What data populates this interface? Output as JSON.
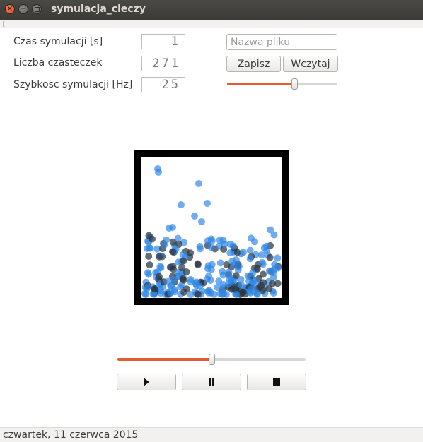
{
  "window": {
    "title": "symulacja_cieczy"
  },
  "params": {
    "time_label": "Czas symulacji [s]",
    "time_value": "1",
    "count_label": "Liczba czasteczek",
    "count_value": "271",
    "speed_label": "Szybkosc symulacji [Hz]",
    "speed_value": "25"
  },
  "file": {
    "filename_placeholder": "Nazwa pliku",
    "save_label": "Zapisz",
    "load_label": "Wczytaj",
    "slider_value": 0.61
  },
  "playback": {
    "slider_value": 0.5,
    "play_icon": "play-icon",
    "pause_icon": "pause-icon",
    "stop_icon": "stop-icon"
  },
  "status": {
    "date": "czwartek, 11 czerwca 2015"
  },
  "colors": {
    "particle_light": "#2d86e6",
    "particle_dark": "#2b3440",
    "accent": "#e55b2f",
    "container": "#000000"
  }
}
